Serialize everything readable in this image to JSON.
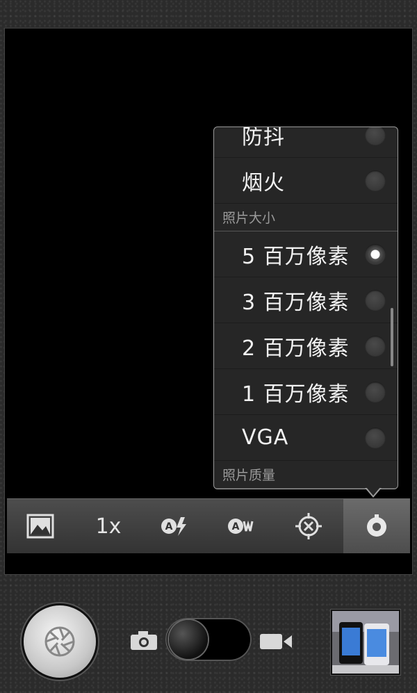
{
  "menu": {
    "items": [
      {
        "label": "防抖",
        "selected": false
      },
      {
        "label": "烟火",
        "selected": false
      }
    ],
    "section_photo_size": "照片大小",
    "size_options": [
      {
        "label": "5 百万像素",
        "selected": true
      },
      {
        "label": "3 百万像素",
        "selected": false
      },
      {
        "label": "2 百万像素",
        "selected": false
      },
      {
        "label": "1 百万像素",
        "selected": false
      },
      {
        "label": "VGA",
        "selected": false
      }
    ],
    "section_photo_quality": "照片质量"
  },
  "toolbar": {
    "zoom_label": "1x",
    "icons": [
      "gallery-icon",
      "zoom-icon",
      "flash-auto-icon",
      "white-balance-auto-icon",
      "focus-target-icon",
      "settings-icon"
    ],
    "active_index": 5
  },
  "controls": {
    "shutter_icon": "aperture-icon",
    "mode_switch": {
      "photo_icon": "camera-icon",
      "video_icon": "video-camera-icon",
      "mode": "photo"
    },
    "thumbnail": "last-photo-thumbnail"
  },
  "colors": {
    "menu_bg": "#262626",
    "menu_border": "#9a9a9a",
    "toolbar_active": "#6b6b6b"
  }
}
